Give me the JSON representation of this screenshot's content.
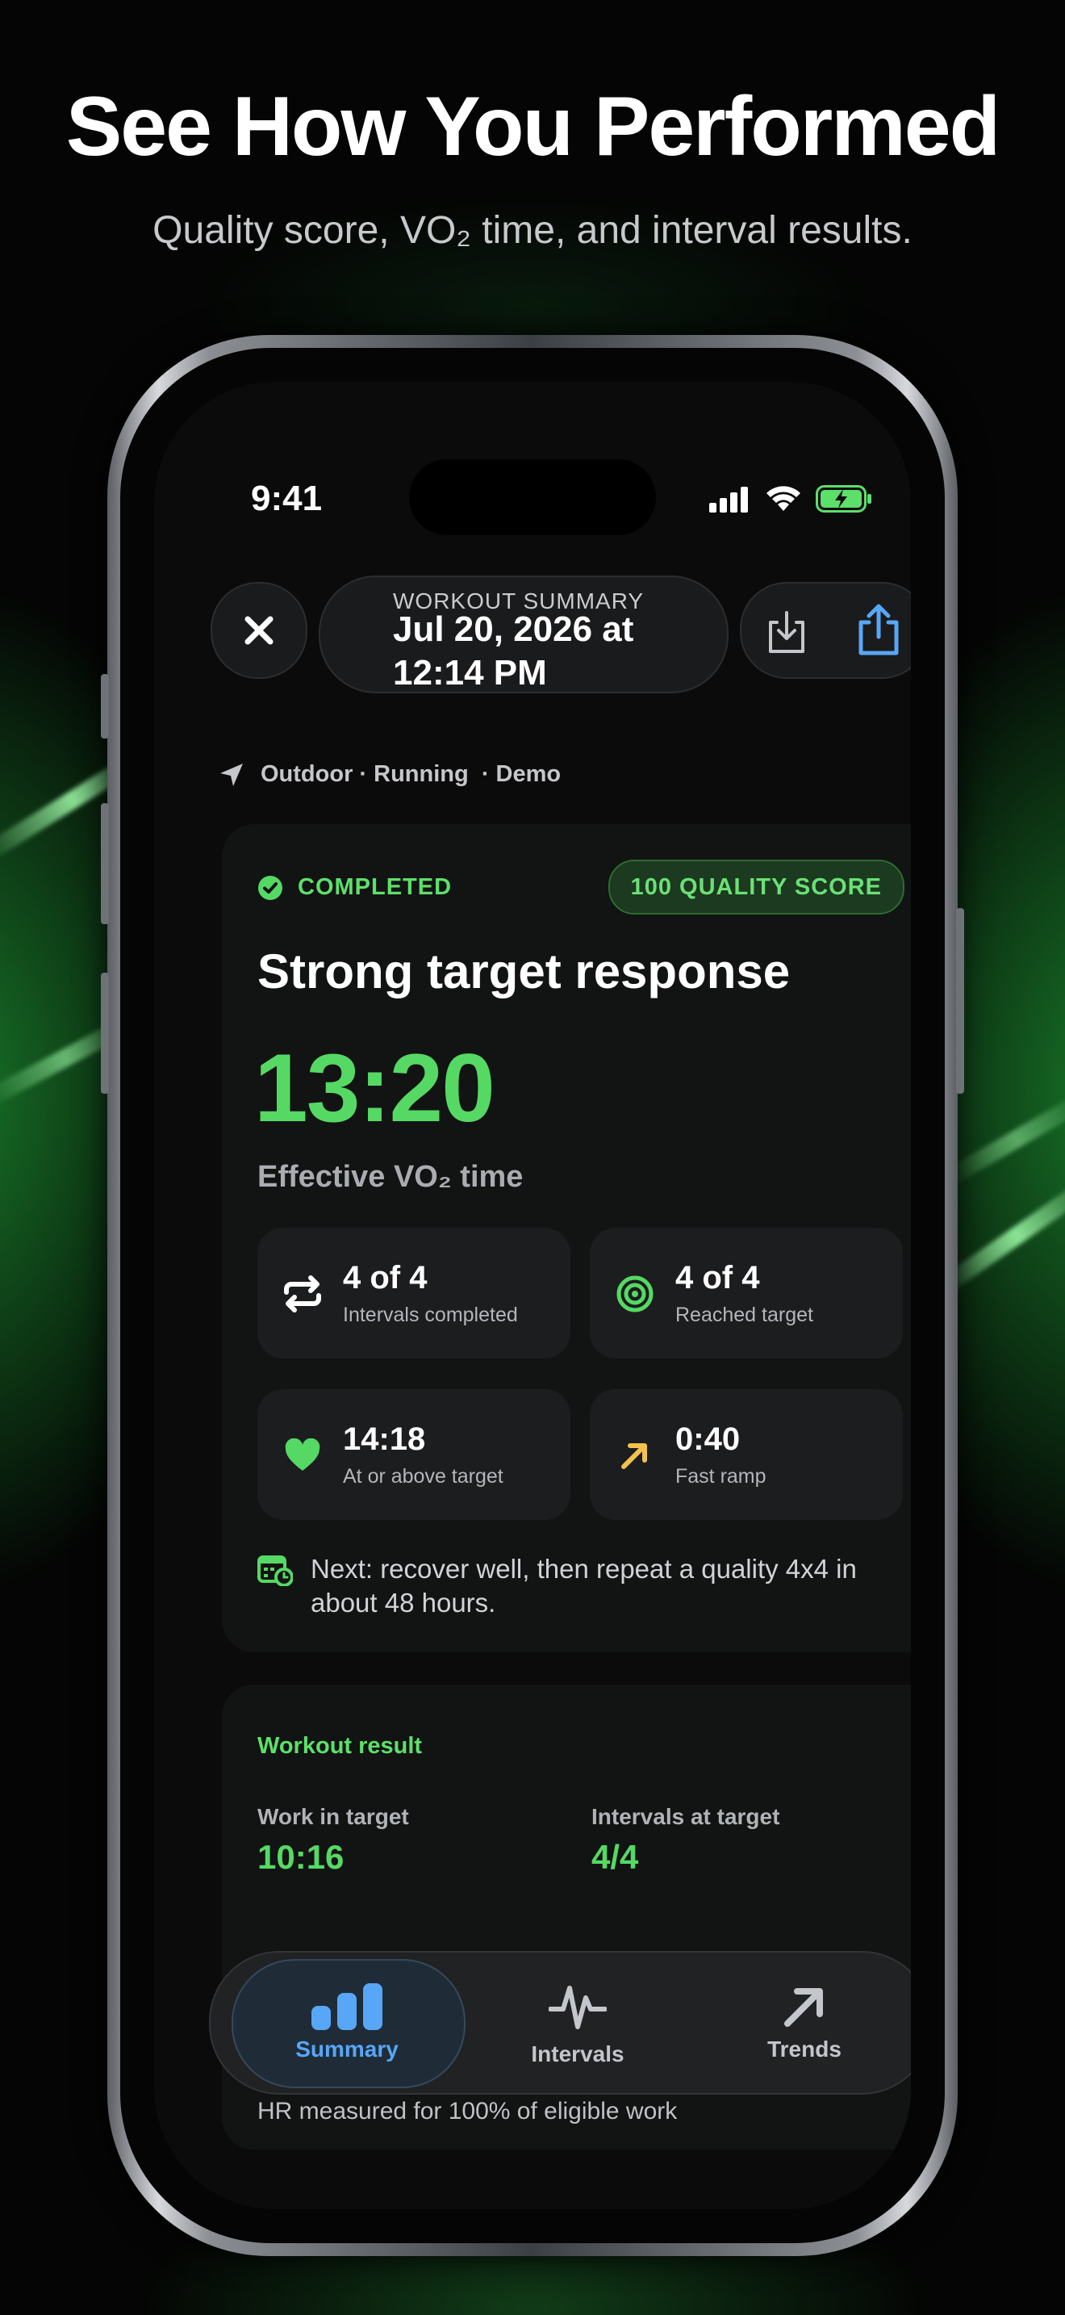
{
  "marketing": {
    "headline": "See How You Performed",
    "subhead": "Quality score, VO₂ time, and interval results."
  },
  "status_bar": {
    "time": "9:41"
  },
  "header": {
    "kicker": "WORKOUT SUMMARY",
    "title": "Jul 20, 2026 at 12:14 PM"
  },
  "meta": {
    "text": "Outdoor · Running  · Demo"
  },
  "summary_card": {
    "status": "COMPLETED",
    "quality_badge": "100 QUALITY SCORE",
    "headline": "Strong target response",
    "vo2_time": "13:20",
    "vo2_label": "Effective VO₂ time",
    "tiles": [
      {
        "value": "4 of 4",
        "label": "Intervals completed",
        "icon": "repeat-icon"
      },
      {
        "value": "4 of 4",
        "label": "Reached target",
        "icon": "target-icon"
      },
      {
        "value": "14:18",
        "label": "At or above target",
        "icon": "heart-icon"
      },
      {
        "value": "0:40",
        "label": "Fast ramp",
        "icon": "arrow-up-right-icon"
      }
    ],
    "next": "Next: recover well, then repeat a quality 4x4 in about 48 hours."
  },
  "result_card": {
    "title": "Workout result",
    "stats": [
      {
        "label": "Work in target",
        "value": "10:16"
      },
      {
        "label": "Intervals at target",
        "value": "4/4"
      }
    ],
    "hr_note": "HR measured for 100% of eligible work"
  },
  "tabs": [
    {
      "label": "Summary",
      "icon": "bar-chart-icon",
      "active": true
    },
    {
      "label": "Intervals",
      "icon": "heartbeat-icon",
      "active": false
    },
    {
      "label": "Trends",
      "icon": "arrow-up-right-icon",
      "active": false
    }
  ],
  "colors": {
    "accent_green": "#55d964",
    "accent_blue": "#58a6f6",
    "ramp_yellow": "#f2c14e"
  }
}
